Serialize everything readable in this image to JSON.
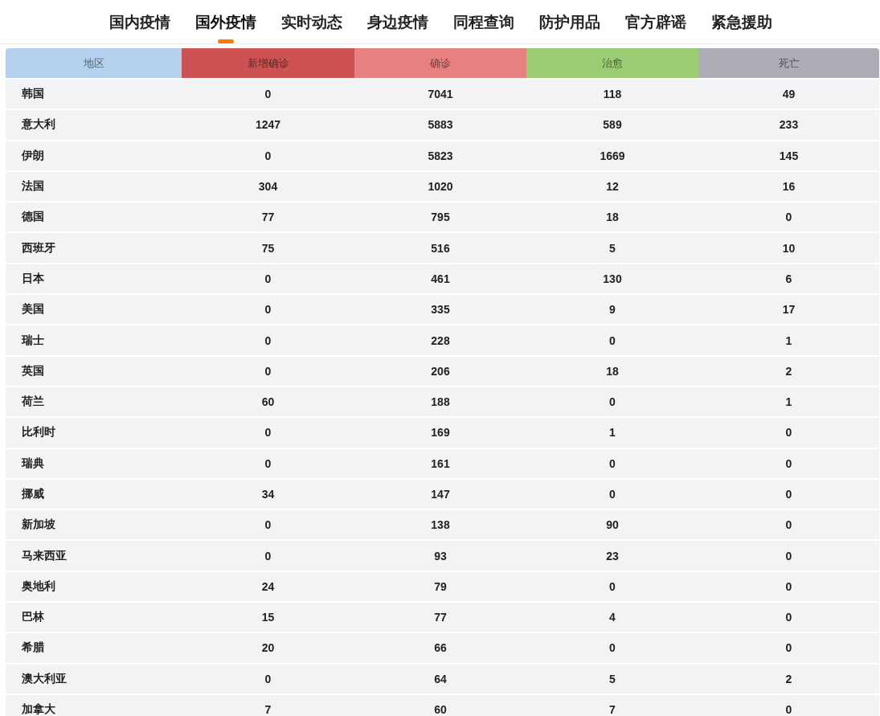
{
  "nav": {
    "tabs": [
      {
        "label": "国内疫情",
        "selected": false
      },
      {
        "label": "国外疫情",
        "selected": true
      },
      {
        "label": "实时动态",
        "selected": false
      },
      {
        "label": "身边疫情",
        "selected": false
      },
      {
        "label": "同程查询",
        "selected": false
      },
      {
        "label": "防护用品",
        "selected": false
      },
      {
        "label": "官方辟谣",
        "selected": false
      },
      {
        "label": "紧急援助",
        "selected": false
      }
    ]
  },
  "table": {
    "columns": [
      {
        "label": "地区",
        "color": "#b3d1ef"
      },
      {
        "label": "新增确诊",
        "color": "#cd5252"
      },
      {
        "label": "确诊",
        "color": "#e98080"
      },
      {
        "label": "治愈",
        "color": "#9acc74"
      },
      {
        "label": "死亡",
        "color": "#aeadb7"
      }
    ],
    "rows": [
      [
        "韩国",
        "0",
        "7041",
        "118",
        "49"
      ],
      [
        "意大利",
        "1247",
        "5883",
        "589",
        "233"
      ],
      [
        "伊朗",
        "0",
        "5823",
        "1669",
        "145"
      ],
      [
        "法国",
        "304",
        "1020",
        "12",
        "16"
      ],
      [
        "德国",
        "77",
        "795",
        "18",
        "0"
      ],
      [
        "西班牙",
        "75",
        "516",
        "5",
        "10"
      ],
      [
        "日本",
        "0",
        "461",
        "130",
        "6"
      ],
      [
        "美国",
        "0",
        "335",
        "9",
        "17"
      ],
      [
        "瑞士",
        "0",
        "228",
        "0",
        "1"
      ],
      [
        "英国",
        "0",
        "206",
        "18",
        "2"
      ],
      [
        "荷兰",
        "60",
        "188",
        "0",
        "1"
      ],
      [
        "比利时",
        "0",
        "169",
        "1",
        "0"
      ],
      [
        "瑞典",
        "0",
        "161",
        "0",
        "0"
      ],
      [
        "挪威",
        "34",
        "147",
        "0",
        "0"
      ],
      [
        "新加坡",
        "0",
        "138",
        "90",
        "0"
      ],
      [
        "马来西亚",
        "0",
        "93",
        "23",
        "0"
      ],
      [
        "奥地利",
        "24",
        "79",
        "0",
        "0"
      ],
      [
        "巴林",
        "15",
        "77",
        "4",
        "0"
      ],
      [
        "希腊",
        "20",
        "66",
        "0",
        "0"
      ],
      [
        "澳大利亚",
        "0",
        "64",
        "5",
        "2"
      ],
      [
        "加拿大",
        "7",
        "60",
        "7",
        "0"
      ]
    ]
  }
}
